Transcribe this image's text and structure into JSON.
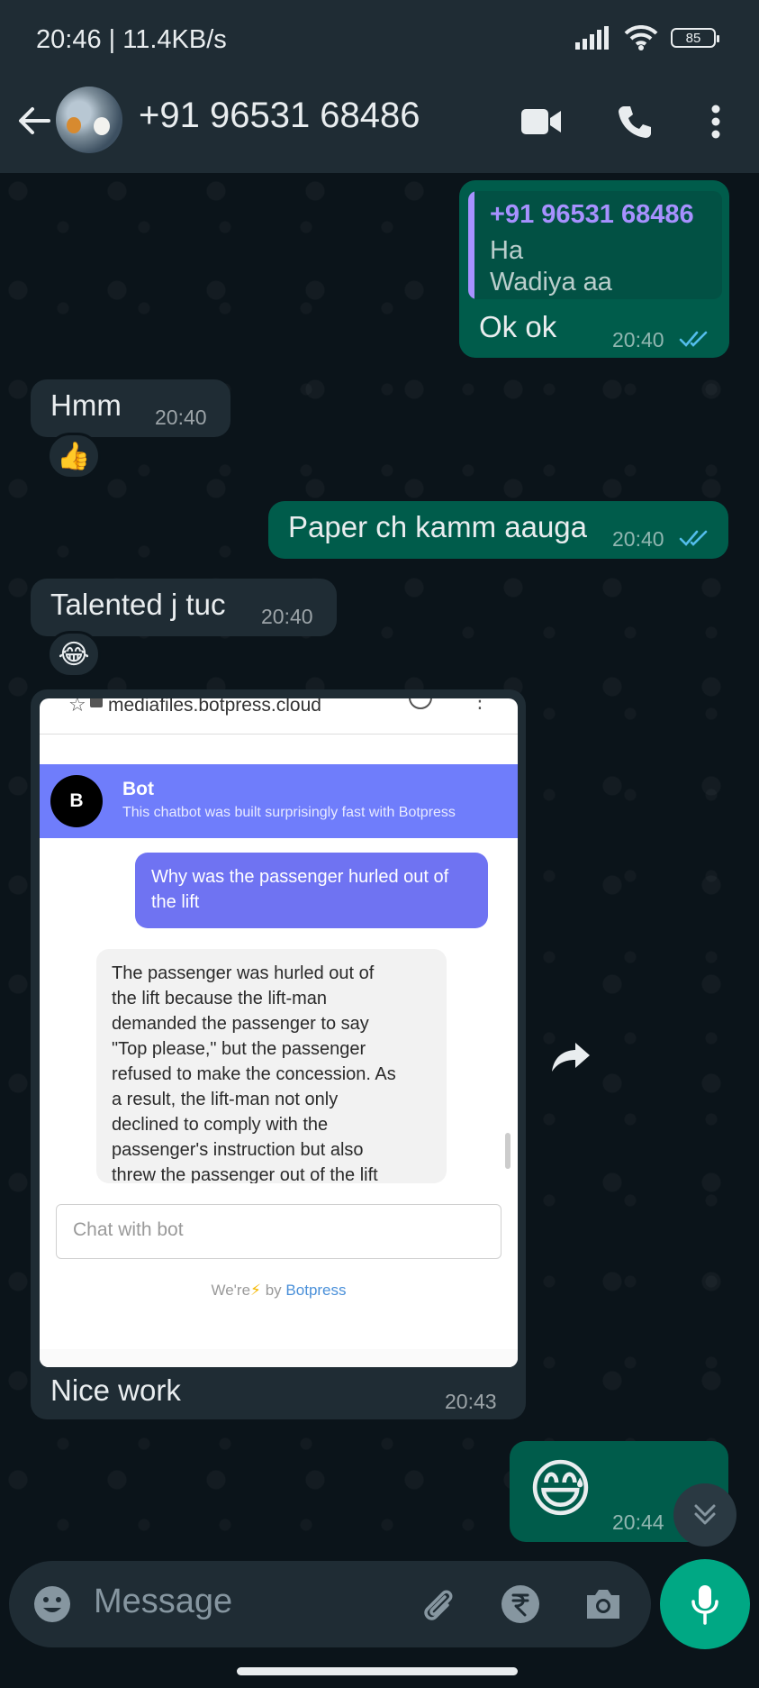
{
  "status_bar": {
    "time_and_speed": "20:46 | 11.4KB/s",
    "battery": "85"
  },
  "header": {
    "contact": "+91 96531 68486"
  },
  "messages": {
    "m1": {
      "quote_name": "+91 96531 68486",
      "quote_line1": "Ha",
      "quote_line2": "Wadiya aa",
      "text": "Ok ok",
      "time": "20:40"
    },
    "m2": {
      "text": "Hmm",
      "time": "20:40",
      "reaction": "👍"
    },
    "m3": {
      "text": "Paper ch kamm aauga",
      "time": "20:40"
    },
    "m4": {
      "text": "Talented j tuc",
      "time": "20:40",
      "reaction": "😂"
    },
    "m5": {
      "caption": "Nice work",
      "time": "20:43",
      "screenshot": {
        "url": "mediafiles.botpress.cloud",
        "bot_avatar": "B",
        "bot_name": "Bot",
        "bot_subtitle": "This chatbot was built surprisingly fast with Botpress",
        "user_question": "Why was the passenger hurled out of the lift",
        "answer_lines": [
          "The passenger was hurled out of",
          "the lift because the lift-man",
          "demanded the passenger to say",
          "\"Top please,\" but the passenger",
          "refused to make the concession. As",
          "a result, the lift-man not only",
          "declined to comply with the",
          "passenger's instruction but also",
          "threw the passenger out of the lift"
        ],
        "input_placeholder": "Chat with bot",
        "powered_prefix": "We're",
        "powered_bolt": "⚡",
        "powered_by": "by",
        "powered_brand": "Botpress"
      }
    },
    "m6": {
      "emoji": "😅",
      "time": "20:44"
    }
  },
  "input": {
    "placeholder": "Message"
  },
  "colors": {
    "outgoing_bubble": "#005c4b",
    "incoming_bubble": "#1f2c34",
    "accent": "#00a884",
    "read_ticks": "#53bdeb",
    "quote_name": "#a791ff",
    "botpress_header": "#6f7dfb"
  },
  "icons": [
    "back-arrow-icon",
    "video-call-icon",
    "voice-call-icon",
    "more-options-icon",
    "double-check-icon",
    "forward-icon",
    "emoji-icon",
    "attach-icon",
    "rupee-payment-icon",
    "camera-icon",
    "mic-icon",
    "chevrons-down-icon"
  ]
}
